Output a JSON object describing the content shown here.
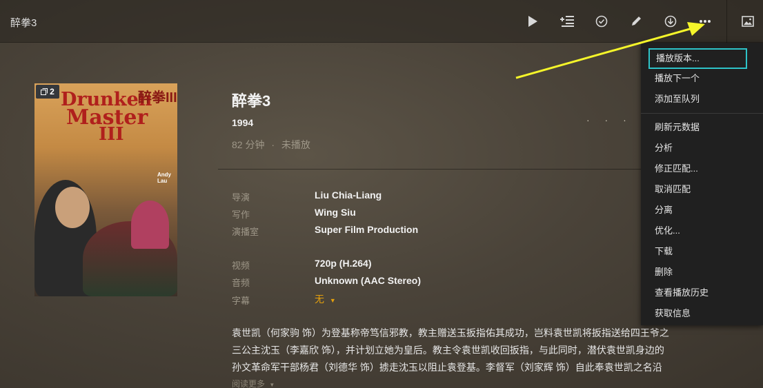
{
  "header": {
    "title": "醉拳3"
  },
  "toolbar": {
    "play_icon": "play-icon",
    "add_to_queue_icon": "add-to-queue-icon",
    "mark_watched_icon": "check-circle-icon",
    "edit_icon": "pencil-icon",
    "download_icon": "download-icon",
    "more_icon": "more-icon",
    "artwork_icon": "image-icon"
  },
  "poster": {
    "version_count": "2",
    "title_line1": "Drunken",
    "title_line2": "Master",
    "title_line3": "III",
    "chinese_title": "醉拳III",
    "credit_name": "Andy Lau"
  },
  "movie": {
    "title": "醉拳3",
    "year": "1994",
    "duration": "82 分钟",
    "separator": "·",
    "status": "未播放",
    "dots": "· · · · ·"
  },
  "details": {
    "director_label": "导演",
    "director": "Liu Chia-Liang",
    "writer_label": "写作",
    "writer": "Wing Siu",
    "studio_label": "演播室",
    "studio": "Super Film Production",
    "video_label": "视频",
    "video": "720p (H.264)",
    "audio_label": "音频",
    "audio": "Unknown (AAC Stereo)",
    "subtitle_label": "字幕",
    "subtitle": "无"
  },
  "summary": {
    "line1": "袁世凯（何家驹 饰）为登基称帝笃信邪教，教主赠送玉扳指佑其成功，岂料袁世凯将扳指送给四王爷之",
    "line2": "三公主沈玉（李嘉欣 饰），并计划立她为皇后。教主令袁世凯收回扳指，与此同时，潜伏袁世凯身边的",
    "line3": "孙文革命军干部杨君（刘德华 饰）掳走沈玉以阻止袁登基。李督军（刘家辉 饰）自此奉袁世凯之名沿",
    "read_more": "阅读更多"
  },
  "menu": {
    "items": [
      "播放版本...",
      "播放下一个",
      "添加至队列",
      "刷新元数据",
      "分析",
      "修正匹配...",
      "取消匹配",
      "分离",
      "优化...",
      "下载",
      "删除",
      "查看播放历史",
      "获取信息"
    ]
  },
  "colors": {
    "accent": "#e5a00d",
    "highlight_border": "#2ec4c9",
    "arrow": "#f5f52a"
  }
}
